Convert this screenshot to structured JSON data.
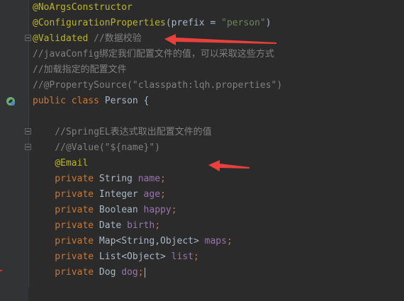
{
  "editor": {
    "lines": [
      {
        "tokens": [
          {
            "t": "@NoArgsConstructor",
            "c": "tok-ann"
          }
        ]
      },
      {
        "tokens": [
          {
            "t": "@ConfigurationProperties",
            "c": "tok-ann"
          },
          {
            "t": "(prefix = ",
            "c": "tok-punct"
          },
          {
            "t": "\"person\"",
            "c": "tok-str"
          },
          {
            "t": ")",
            "c": "tok-punct"
          }
        ]
      },
      {
        "tokens": [
          {
            "t": "@Validated",
            "c": "tok-ann"
          },
          {
            "t": " //数据校验",
            "c": "tok-com"
          }
        ]
      },
      {
        "tokens": [
          {
            "t": "//javaConfig绑定我们配置文件的值，可以采取这些方式",
            "c": "tok-com"
          }
        ]
      },
      {
        "tokens": [
          {
            "t": "//加载指定的配置文件",
            "c": "tok-com"
          }
        ]
      },
      {
        "tokens": [
          {
            "t": "//@PropertySource(\"classpath:lqh.properties\")",
            "c": "tok-com"
          }
        ]
      },
      {
        "tokens": [
          {
            "t": "public ",
            "c": "tok-kw"
          },
          {
            "t": "class ",
            "c": "tok-kw"
          },
          {
            "t": "Person {",
            "c": "tok-type"
          }
        ]
      },
      {
        "tokens": []
      },
      {
        "tokens": [
          {
            "t": "    //SpringEL表达式取出配置文件的值",
            "c": "tok-com"
          }
        ]
      },
      {
        "tokens": [
          {
            "t": "    //@Value(\"${name}\")",
            "c": "tok-com"
          }
        ]
      },
      {
        "tokens": [
          {
            "t": "    ",
            "c": "tok-punct"
          },
          {
            "t": "@Email",
            "c": "tok-ann"
          }
        ]
      },
      {
        "tokens": [
          {
            "t": "    private ",
            "c": "tok-kw"
          },
          {
            "t": "String ",
            "c": "tok-type"
          },
          {
            "t": "name",
            "c": "tok-field"
          },
          {
            "t": ";",
            "c": "tok-kw"
          }
        ]
      },
      {
        "tokens": [
          {
            "t": "    private ",
            "c": "tok-kw"
          },
          {
            "t": "Integer ",
            "c": "tok-type"
          },
          {
            "t": "age",
            "c": "tok-field"
          },
          {
            "t": ";",
            "c": "tok-kw"
          }
        ]
      },
      {
        "tokens": [
          {
            "t": "    private ",
            "c": "tok-kw"
          },
          {
            "t": "Boolean ",
            "c": "tok-type"
          },
          {
            "t": "happy",
            "c": "tok-field"
          },
          {
            "t": ";",
            "c": "tok-kw"
          }
        ]
      },
      {
        "tokens": [
          {
            "t": "    private ",
            "c": "tok-kw"
          },
          {
            "t": "Date ",
            "c": "tok-type"
          },
          {
            "t": "birth",
            "c": "tok-field"
          },
          {
            "t": ";",
            "c": "tok-kw"
          }
        ]
      },
      {
        "tokens": [
          {
            "t": "    private ",
            "c": "tok-kw"
          },
          {
            "t": "Map<String,Object> ",
            "c": "tok-type"
          },
          {
            "t": "maps",
            "c": "tok-field"
          },
          {
            "t": ";",
            "c": "tok-kw"
          }
        ]
      },
      {
        "tokens": [
          {
            "t": "    private ",
            "c": "tok-kw"
          },
          {
            "t": "List<Object> ",
            "c": "tok-type"
          },
          {
            "t": "list",
            "c": "tok-field"
          },
          {
            "t": ";",
            "c": "tok-kw"
          }
        ]
      },
      {
        "tokens": [
          {
            "t": "    private ",
            "c": "tok-kw"
          },
          {
            "t": "Dog ",
            "c": "tok-type"
          },
          {
            "t": "dog",
            "c": "tok-field"
          },
          {
            "t": ";",
            "c": "tok-kw"
          }
        ],
        "caret": true
      }
    ]
  },
  "colors": {
    "background": "#2b2b2b",
    "annotation": "#bbb529",
    "keyword": "#cc7832",
    "string": "#6a8759",
    "comment": "#808080",
    "field": "#9876aa",
    "text": "#a9b7c6",
    "arrow": "#e8403a"
  },
  "gutter_icons": [
    "spring-bean-icon"
  ],
  "annotations_arrows": [
    "arrow-to-validated",
    "arrow-to-email"
  ]
}
